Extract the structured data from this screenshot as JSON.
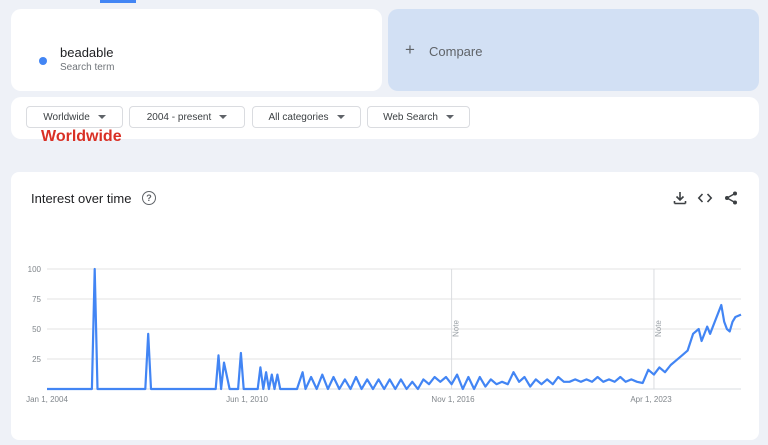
{
  "search": {
    "term": "beadable",
    "term_type": "Search term",
    "term_color": "#4285f4",
    "compare_label": "Compare"
  },
  "filters": {
    "region": "Worldwide",
    "period": "2004 - present",
    "category": "All categories",
    "property": "Web Search"
  },
  "annotation": "Worldwide",
  "card": {
    "title": "Interest over time",
    "help_icon": "help-circle-icon",
    "actions": [
      "download-icon",
      "embed-code-icon",
      "share-icon"
    ]
  },
  "chart_data": {
    "type": "line",
    "title": "",
    "series": [
      {
        "name": "beadable",
        "color": "#4285f4"
      }
    ],
    "yticks": [
      25,
      50,
      75,
      100
    ],
    "ylim": [
      0,
      100
    ],
    "xlim": [
      "2004-01-01",
      "2024-08-01"
    ],
    "xticks": [
      "Jan 1, 2004",
      "Jun 1, 2010",
      "Nov 1, 2016",
      "Apr 1, 2023"
    ],
    "notes": [
      {
        "label": "Note",
        "date": "2016-01-01"
      },
      {
        "label": "Note",
        "date": "2022-01-01"
      }
    ],
    "points": [
      [
        "2004-01-01",
        0
      ],
      [
        "2005-01-01",
        0
      ],
      [
        "2005-05-01",
        0
      ],
      [
        "2005-06-01",
        100
      ],
      [
        "2005-07-01",
        0
      ],
      [
        "2006-12-01",
        0
      ],
      [
        "2007-01-01",
        46
      ],
      [
        "2007-02-01",
        0
      ],
      [
        "2009-01-01",
        0
      ],
      [
        "2009-02-01",
        28
      ],
      [
        "2009-03-01",
        0
      ],
      [
        "2009-04-01",
        22
      ],
      [
        "2009-06-01",
        0
      ],
      [
        "2009-09-01",
        0
      ],
      [
        "2009-10-01",
        30
      ],
      [
        "2009-11-01",
        0
      ],
      [
        "2010-04-01",
        0
      ],
      [
        "2010-05-01",
        18
      ],
      [
        "2010-06-01",
        0
      ],
      [
        "2010-07-01",
        14
      ],
      [
        "2010-08-01",
        0
      ],
      [
        "2010-09-01",
        12
      ],
      [
        "2010-10-01",
        0
      ],
      [
        "2010-11-01",
        12
      ],
      [
        "2010-12-01",
        0
      ],
      [
        "2011-06-01",
        0
      ],
      [
        "2011-08-01",
        14
      ],
      [
        "2011-09-01",
        0
      ],
      [
        "2011-11-01",
        10
      ],
      [
        "2012-01-01",
        0
      ],
      [
        "2012-03-01",
        12
      ],
      [
        "2012-05-01",
        0
      ],
      [
        "2012-07-01",
        10
      ],
      [
        "2012-09-01",
        0
      ],
      [
        "2012-11-01",
        8
      ],
      [
        "2013-01-01",
        0
      ],
      [
        "2013-03-01",
        10
      ],
      [
        "2013-05-01",
        0
      ],
      [
        "2013-07-01",
        8
      ],
      [
        "2013-09-01",
        0
      ],
      [
        "2013-11-01",
        8
      ],
      [
        "2014-01-01",
        0
      ],
      [
        "2014-03-01",
        8
      ],
      [
        "2014-05-01",
        0
      ],
      [
        "2014-07-01",
        8
      ],
      [
        "2014-09-01",
        0
      ],
      [
        "2014-11-01",
        6
      ],
      [
        "2015-01-01",
        0
      ],
      [
        "2015-03-01",
        8
      ],
      [
        "2015-05-01",
        4
      ],
      [
        "2015-07-01",
        10
      ],
      [
        "2015-09-01",
        6
      ],
      [
        "2015-11-01",
        10
      ],
      [
        "2016-01-01",
        4
      ],
      [
        "2016-03-01",
        12
      ],
      [
        "2016-05-01",
        0
      ],
      [
        "2016-07-01",
        10
      ],
      [
        "2016-09-01",
        0
      ],
      [
        "2016-11-01",
        10
      ],
      [
        "2017-01-01",
        2
      ],
      [
        "2017-03-01",
        8
      ],
      [
        "2017-05-01",
        4
      ],
      [
        "2017-07-01",
        6
      ],
      [
        "2017-09-01",
        4
      ],
      [
        "2017-11-01",
        14
      ],
      [
        "2018-01-01",
        6
      ],
      [
        "2018-03-01",
        10
      ],
      [
        "2018-05-01",
        2
      ],
      [
        "2018-07-01",
        8
      ],
      [
        "2018-09-01",
        4
      ],
      [
        "2018-11-01",
        8
      ],
      [
        "2019-01-01",
        4
      ],
      [
        "2019-03-01",
        10
      ],
      [
        "2019-05-01",
        6
      ],
      [
        "2019-07-01",
        6
      ],
      [
        "2019-09-01",
        8
      ],
      [
        "2019-11-01",
        6
      ],
      [
        "2020-01-01",
        8
      ],
      [
        "2020-03-01",
        6
      ],
      [
        "2020-05-01",
        10
      ],
      [
        "2020-07-01",
        6
      ],
      [
        "2020-09-01",
        8
      ],
      [
        "2020-11-01",
        6
      ],
      [
        "2021-01-01",
        10
      ],
      [
        "2021-03-01",
        6
      ],
      [
        "2021-05-01",
        8
      ],
      [
        "2021-07-01",
        6
      ],
      [
        "2021-09-01",
        5
      ],
      [
        "2021-11-01",
        16
      ],
      [
        "2022-01-01",
        12
      ],
      [
        "2022-03-01",
        18
      ],
      [
        "2022-05-01",
        14
      ],
      [
        "2022-07-01",
        20
      ],
      [
        "2022-09-01",
        24
      ],
      [
        "2022-11-01",
        28
      ],
      [
        "2023-01-01",
        32
      ],
      [
        "2023-03-01",
        46
      ],
      [
        "2023-05-01",
        50
      ],
      [
        "2023-06-01",
        40
      ],
      [
        "2023-08-01",
        52
      ],
      [
        "2023-09-01",
        46
      ],
      [
        "2023-11-01",
        58
      ],
      [
        "2024-01-01",
        70
      ],
      [
        "2024-02-01",
        56
      ],
      [
        "2024-03-01",
        50
      ],
      [
        "2024-04-01",
        48
      ],
      [
        "2024-05-01",
        56
      ],
      [
        "2024-06-01",
        60
      ],
      [
        "2024-08-01",
        62
      ]
    ]
  }
}
